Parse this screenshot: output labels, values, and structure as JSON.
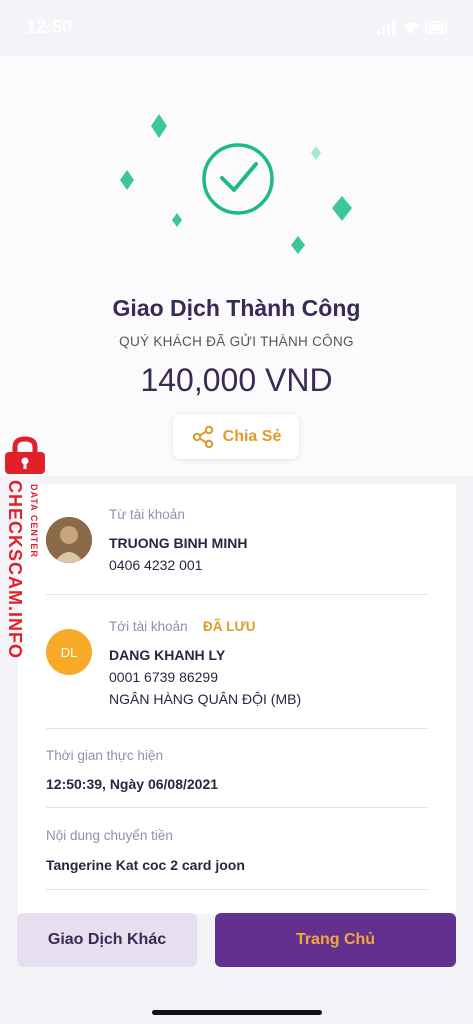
{
  "status_bar": {
    "time": "12:50"
  },
  "result": {
    "title": "Giao Dịch Thành Công",
    "subtitle": "QUÝ KHÁCH ĐÃ GỬI THÀNH CÔNG",
    "amount": "140,000 VND",
    "share_label": "Chia Sẻ"
  },
  "colors": {
    "success": "#1dbb83",
    "accent": "#e09a2a",
    "primary": "#63308f"
  },
  "from_account": {
    "label": "Từ tài khoản",
    "name": "TRUONG BINH MINH",
    "number": "0406 4232 001"
  },
  "to_account": {
    "label": "Tới tài khoản",
    "saved_badge": "ĐÃ LƯU",
    "initials": "DL",
    "name": "DANG KHANH LY",
    "number": "0001 6739 86299",
    "bank": "NGÂN HÀNG QUÂN ĐỘI (MB)"
  },
  "time_block": {
    "label": "Thời gian thực hiện",
    "value": "12:50:39, Ngày 06/08/2021"
  },
  "content_block": {
    "label": "Nội dung chuyển tiền",
    "value": "Tangerine Kat coc 2 card joon"
  },
  "buttons": {
    "other": "Giao Dịch Khác",
    "home": "Trang Chủ"
  },
  "watermark": {
    "main": "CHECKSCAM.INFO",
    "small": "DATA CENTER"
  }
}
